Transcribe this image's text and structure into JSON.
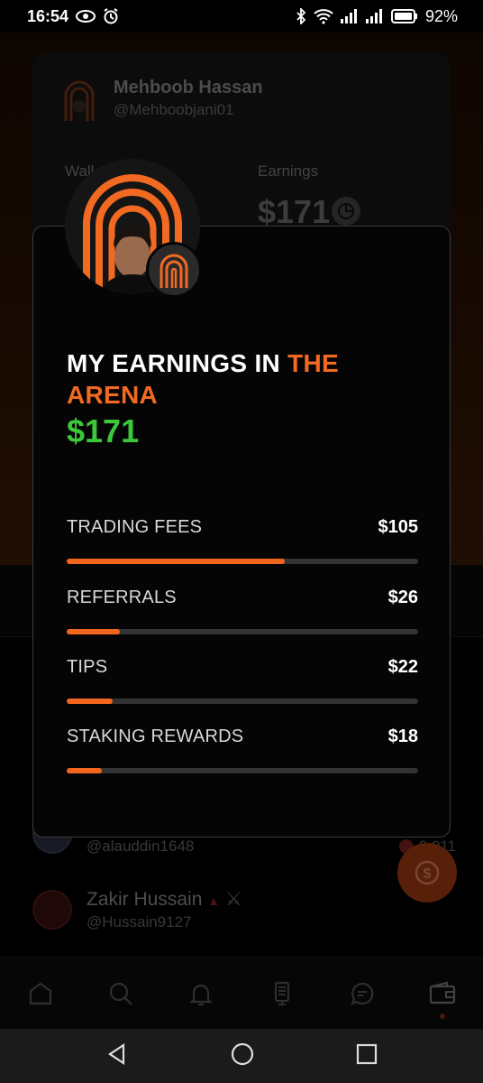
{
  "status_bar": {
    "time": "16:54",
    "battery": "92%"
  },
  "background": {
    "profile": {
      "name": "Mehboob Hassan",
      "handle": "@Mehboobjani01",
      "wallet_label": "Wall",
      "earnings_label": "Earnings",
      "earnings_value": "$171"
    },
    "list": [
      {
        "name": "",
        "handle": "@alauddin1648",
        "value": "0.011"
      },
      {
        "name": "Zakir Hussain",
        "handle": "@Hussain9127",
        "value": ""
      }
    ]
  },
  "modal": {
    "title_part1": "MY EARNINGS IN ",
    "title_accent_1": "THE",
    "title_accent_2": "ARENA",
    "total": "$171",
    "items": [
      {
        "label": "TRADING FEES",
        "value": "$105",
        "fraction": 0.62
      },
      {
        "label": "REFERRALS",
        "value": "$26",
        "fraction": 0.15
      },
      {
        "label": "TIPS",
        "value": "$22",
        "fraction": 0.13
      },
      {
        "label": "STAKING REWARDS",
        "value": "$18",
        "fraction": 0.1
      }
    ]
  },
  "nav": {
    "items": [
      "home-icon",
      "search-icon",
      "bell-icon",
      "device-icon",
      "chat-icon",
      "wallet-icon"
    ],
    "active": "wallet-icon"
  },
  "colors": {
    "accent": "#f26a22",
    "total_green": "#3cc83a",
    "bar_track": "#333333"
  }
}
